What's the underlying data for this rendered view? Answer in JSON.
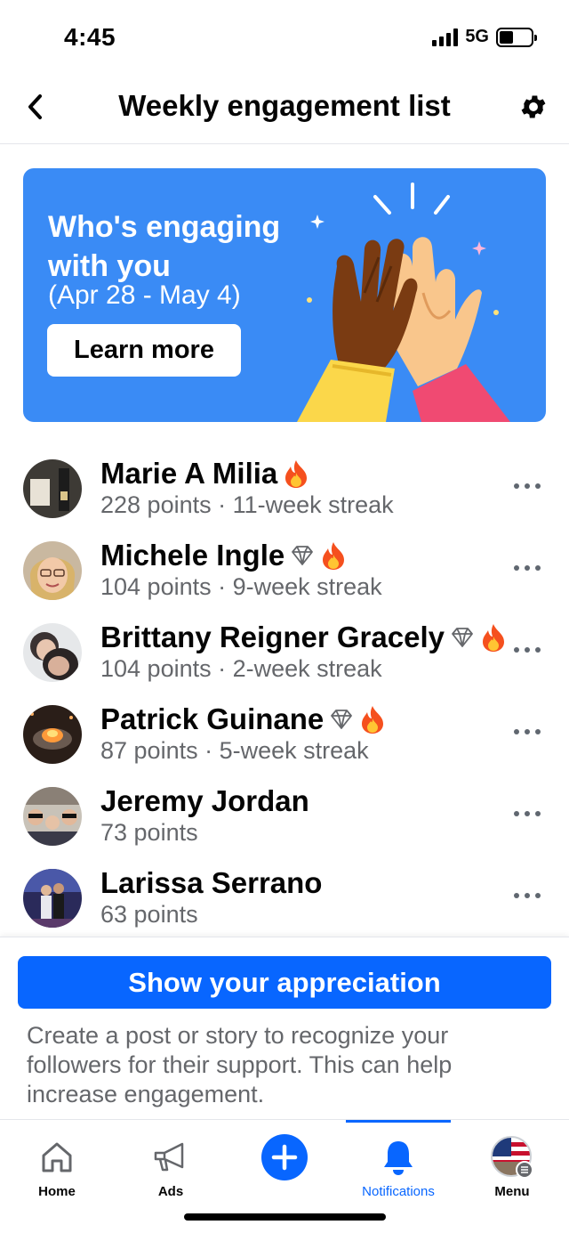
{
  "status_bar": {
    "time": "4:45",
    "network": "5G"
  },
  "header": {
    "title": "Weekly engagement list"
  },
  "banner": {
    "title": "Who's engaging with you",
    "date_range": "(Apr 28 - May 4)",
    "button_label": "Learn more",
    "bg_color": "#3a8bf5"
  },
  "list": [
    {
      "name": "Marie A Milia",
      "subtitle": "228 points · 11-week streak",
      "badges": [
        "fire-icon"
      ]
    },
    {
      "name": "Michele Ingle",
      "subtitle": "104 points · 9-week streak",
      "badges": [
        "diamond-icon",
        "fire-icon"
      ]
    },
    {
      "name": "Brittany Reigner Gracely",
      "subtitle": "104 points · 2-week streak",
      "badges": [
        "diamond-icon",
        "fire-icon"
      ]
    },
    {
      "name": "Patrick Guinane",
      "subtitle": "87 points · 5-week streak",
      "badges": [
        "diamond-icon",
        "fire-icon"
      ]
    },
    {
      "name": "Jeremy Jordan",
      "subtitle": "73 points",
      "badges": []
    },
    {
      "name": "Larissa Serrano",
      "subtitle": "63 points",
      "badges": []
    }
  ],
  "appreciation": {
    "button_label": "Show your appreciation",
    "description": "Create a post or story to recognize your followers for their support. This can help increase engagement."
  },
  "tabs": [
    {
      "label": "Home",
      "icon": "home-icon"
    },
    {
      "label": "Ads",
      "icon": "megaphone-icon"
    },
    {
      "label": "",
      "icon": "plus-icon"
    },
    {
      "label": "Notifications",
      "icon": "bell-icon",
      "active": true
    },
    {
      "label": "Menu",
      "icon": "avatar-menu-icon"
    }
  ],
  "colors": {
    "accent": "#0866ff",
    "secondary_text": "#65676b"
  }
}
